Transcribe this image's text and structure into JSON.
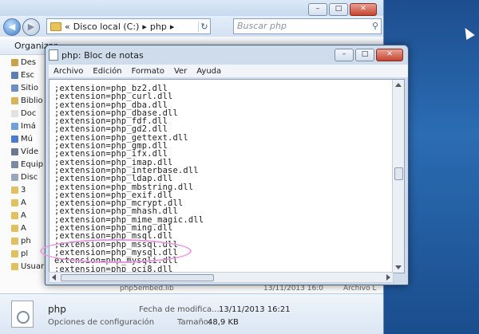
{
  "explorer": {
    "breadcrumb": [
      "«",
      "Disco local (C:)",
      "php"
    ],
    "search_placeholder": "Buscar php",
    "toolbar_label": "Organizar",
    "sidebar_items": [
      {
        "label": "Des",
        "color": "#c9a24a"
      },
      {
        "label": "Esc",
        "color": "#5f7fb3"
      },
      {
        "label": "Sitio",
        "color": "#6b8fc4"
      },
      {
        "label": "Biblio",
        "color": "#d8b35a"
      },
      {
        "label": "Doc",
        "color": "#e2e2e2"
      },
      {
        "label": "Imá",
        "color": "#6fa0d8"
      },
      {
        "label": "Mú",
        "color": "#4b7bd0"
      },
      {
        "label": "Víde",
        "color": "#6b7a90"
      },
      {
        "label": "Equip",
        "color": "#7a8aa3"
      },
      {
        "label": "Disc",
        "color": "#9aa8bb"
      },
      {
        "label": "3",
        "color": "#e0c060"
      },
      {
        "label": "A",
        "color": "#e0c060"
      },
      {
        "label": "A",
        "color": "#e0c060"
      },
      {
        "label": "A",
        "color": "#e0c060"
      },
      {
        "label": "ph",
        "color": "#e0c060"
      },
      {
        "label": "pl",
        "color": "#e0c060"
      },
      {
        "label": "Usuarios",
        "color": "#e0c060"
      }
    ],
    "background_file": "php5embed.lib",
    "background_date": "13/11/2013 16:0",
    "background_type": "Archivo L",
    "details": {
      "name": "php",
      "type": "Opciones de configuración",
      "modified_label": "Fecha de modifica...",
      "modified_value": "13/11/2013 16:21",
      "size_label": "Tamaño:",
      "size_value": "48,9 KB"
    }
  },
  "notepad": {
    "title": "php: Bloc de notas",
    "menu": [
      "Archivo",
      "Edición",
      "Formato",
      "Ver",
      "Ayuda"
    ],
    "lines": [
      ";extension=php_bz2.dll",
      ";extension=php_curl.dll",
      ";extension=php_dba.dll",
      ";extension=php_dbase.dll",
      ";extension=php_fdf.dll",
      ";extension=php_gd2.dll",
      ";extension=php_gettext.dll",
      ";extension=php_gmp.dll",
      ";extension=php_ifx.dll",
      ";extension=php_imap.dll",
      ";extension=php_interbase.dll",
      ";extension=php_ldap.dll",
      ";extension=php_mbstring.dll",
      ";extension=php_exif.dll",
      ";extension=php_mcrypt.dll",
      ";extension=php_mhash.dll",
      ";extension=php_mime_magic.dll",
      ";extension=php_ming.dll",
      ";extension=php_msql.dll",
      ";extension=php_mssql.dll",
      ";extension=php_mysql.dll",
      "extension=php_mysqli.dll",
      ";extension=php_oci8.dll"
    ]
  }
}
